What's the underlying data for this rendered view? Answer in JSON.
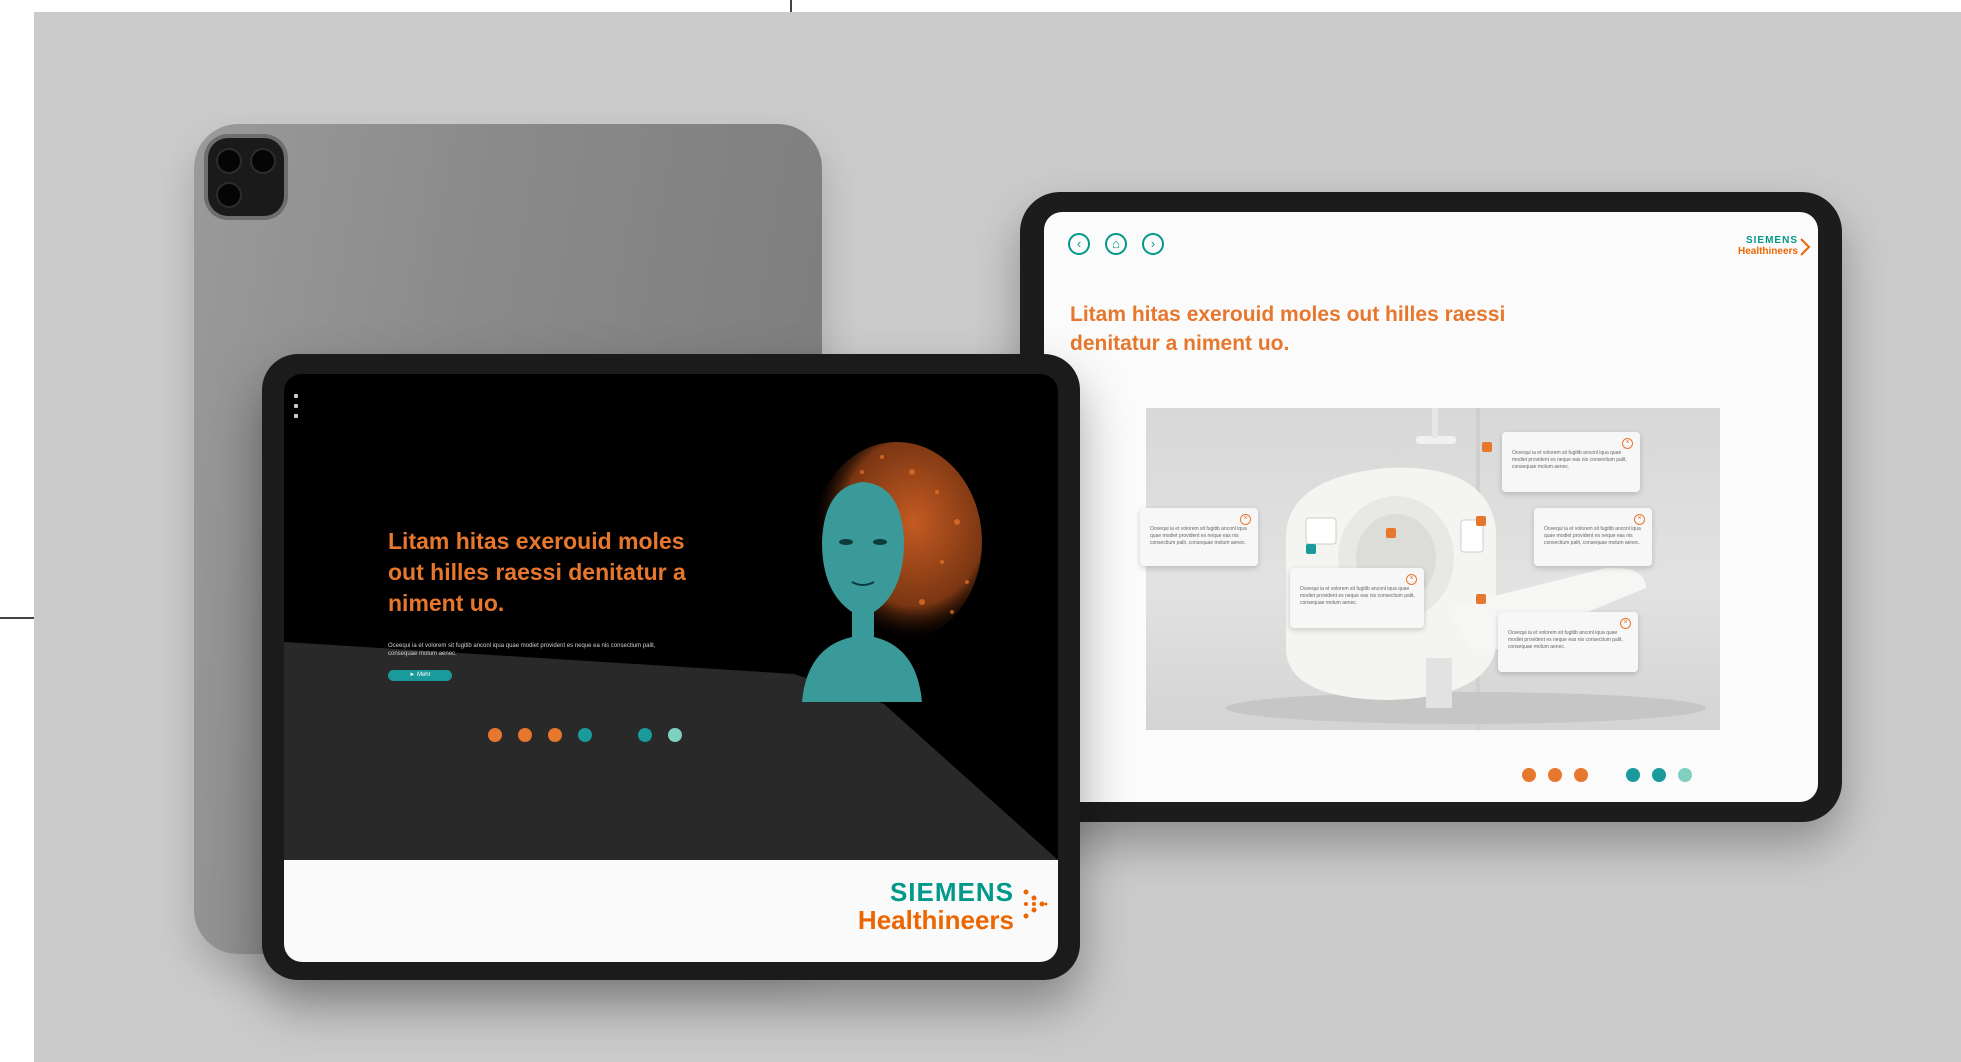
{
  "front": {
    "headline": "Litam hitas exerouid moles out hilles raessi denitatur a niment uo.",
    "body_text": "Oceequi ia et volorem sit fugitib anconl iqua quae modiet provident es neque ea nis consectium palit, consequae molum aenec.",
    "cta_label": "► Mehr",
    "logo": {
      "line1": "SIEMENS",
      "line2": "Healthineers"
    },
    "pagination": [
      "#e8772e",
      "#e8772e",
      "#e8772e",
      "#1a9a9a",
      "#1a9a9a",
      "#7fd0bf"
    ]
  },
  "right": {
    "nav": [
      {
        "icon": "chevron-left-icon",
        "glyph": "‹"
      },
      {
        "icon": "home-icon",
        "glyph": "⌂"
      },
      {
        "icon": "chevron-right-icon",
        "glyph": "›"
      }
    ],
    "logo": {
      "line1": "SIEMENS",
      "line2": "Healthineers"
    },
    "headline": "Litam hitas exerouid moles out hilles raessi denitatur a niment uo.",
    "callouts": [
      "Oceequi ia et volorem sit fugitib anconl iqua quae modiet provident es neque eas nis consectium palit, consequae molum aenec.",
      "Oceequi ia et volorem sit fugitib anconl iqua quae modiet provident es neque eas nis consectium palit, consequae molum aenec.",
      "Oceequi ia et volorem sit fugitib anconl iqua quae modiet provident es neque eas nis consectium palit, consequae molum aenec.",
      "Oceequi ia et volorem sit fugitib anconl iqua quae modiet provident es neque eas nis consectium palit, consequae molum aenec.",
      "Oceequi ia et volorem sit fugitib anconl iqua quae modiet provident es neque eas nis consectium palit, consequae molum aenec."
    ],
    "pagination": [
      "#e8772e",
      "#e8772e",
      "#e8772e",
      "#1a9a9a",
      "#1a9a9a",
      "#7fd0bf"
    ]
  },
  "colors": {
    "brand_orange": "#ec6602",
    "brand_teal": "#00998a",
    "backdrop": "#cbcbcb"
  }
}
